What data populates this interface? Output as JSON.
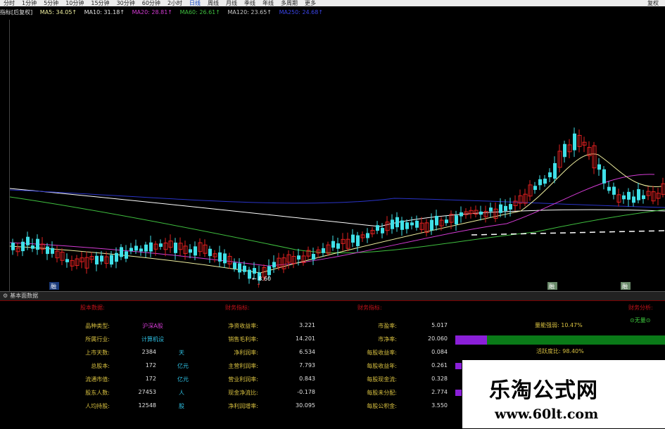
{
  "toolbar": {
    "items": [
      "分时",
      "1分钟",
      "5分钟",
      "10分钟",
      "15分钟",
      "30分钟",
      "60分钟",
      "2小时",
      "日线",
      "周线",
      "月线",
      "季线",
      "年线",
      "多周期",
      "更多"
    ],
    "active_index": 8,
    "right_label": "复权"
  },
  "indicators": {
    "name": "指标[后复权]",
    "ma5": "MA5: 34.05↑",
    "ma10": "MA10: 31.18↑",
    "ma20": "MA20: 28.81↑",
    "ma60": "MA60: 26.61↑",
    "ma120": "MA120: 23.65↑",
    "ma250": "MA250: 24.68↑"
  },
  "chart_data": {
    "type": "candlestick",
    "low_marker": "8.60",
    "lines": [
      {
        "name": "MA5",
        "color": "#f0f0a0"
      },
      {
        "name": "MA10",
        "color": "#e0e0e0"
      },
      {
        "name": "MA20",
        "color": "#d43bd4"
      },
      {
        "name": "MA60",
        "color": "#3fbf3f"
      },
      {
        "name": "MA120",
        "color": "#c8c8c8"
      },
      {
        "name": "MA250",
        "color": "#2a34c8"
      }
    ],
    "markers": [
      "融",
      "融",
      "融"
    ]
  },
  "bottom_tab": {
    "label": "基本面数据"
  },
  "panel": {
    "headers": [
      "股本数据:",
      "财务指标:",
      "财务指标:",
      "财务分析:"
    ],
    "col1": [
      {
        "label": "品种类型:",
        "value": "沪深A股",
        "unit": ""
      },
      {
        "label": "所属行业:",
        "value": "计算机设",
        "unit": ""
      },
      {
        "label": "上市天数:",
        "value": "2384",
        "unit": "天"
      },
      {
        "label": "总股本:",
        "value": "172",
        "unit": "亿元"
      },
      {
        "label": "流通市值:",
        "value": "172",
        "unit": "亿元"
      },
      {
        "label": "股东人数:",
        "value": "27453",
        "unit": "人"
      },
      {
        "label": "人均持股:",
        "value": "12548",
        "unit": "股"
      }
    ],
    "col2": [
      {
        "label": "净资收益率:",
        "value": "3.221"
      },
      {
        "label": "销售毛利率:",
        "value": "14.201"
      },
      {
        "label": "净利润率:",
        "value": "6.534"
      },
      {
        "label": "主营利润率:",
        "value": "7.793"
      },
      {
        "label": "营业利润率:",
        "value": "0.843"
      },
      {
        "label": "现金净流比:",
        "value": "-0.178"
      },
      {
        "label": "净利润增率:",
        "value": "30.095"
      }
    ],
    "col3": [
      {
        "label": "市盈率:",
        "value": "5.017"
      },
      {
        "label": "市净率:",
        "value": "20.060"
      },
      {
        "label": "每股收益率:",
        "value": "0.084"
      },
      {
        "label": "每股收益年:",
        "value": "0.261"
      },
      {
        "label": "每股现金流:",
        "value": "0.328"
      },
      {
        "label": "每股未分配:",
        "value": "2.774"
      },
      {
        "label": "每股公积金:",
        "value": "3.550"
      }
    ],
    "col4": {
      "line1": "量能强弱: 10.47%",
      "line2": "⊙无量⊙",
      "line3": "活跃度比: 98.40%",
      "bar_ratio": 0.15
    }
  },
  "watermark": {
    "title": "乐淘公式网",
    "url": "www.60lt.com"
  }
}
